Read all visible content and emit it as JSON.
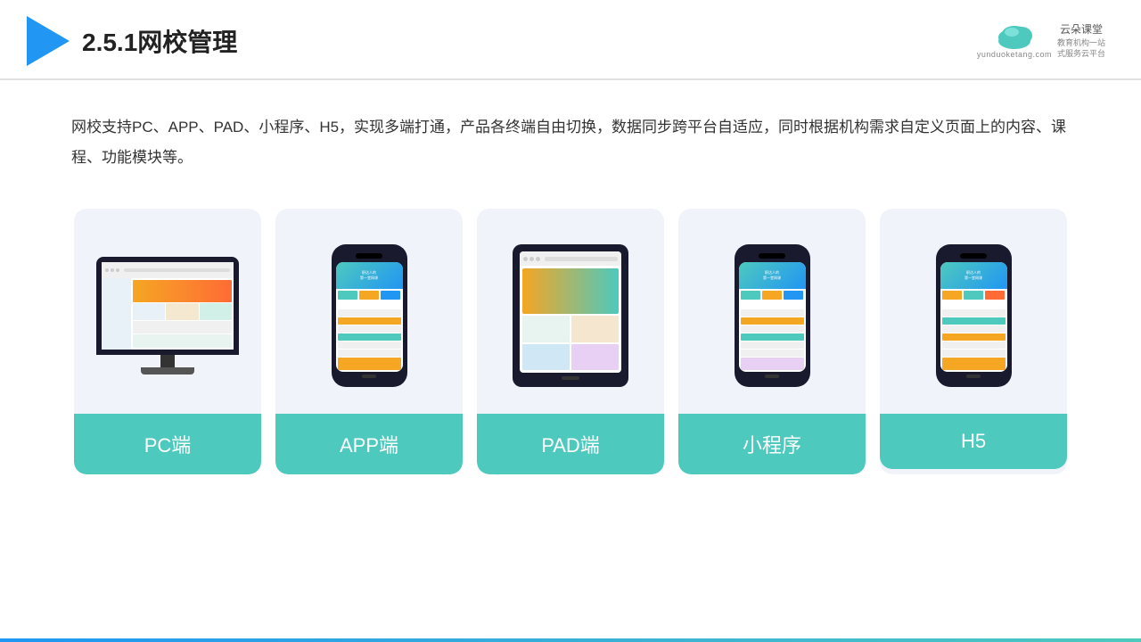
{
  "header": {
    "title": "2.5.1网校管理",
    "brand_name": "云朵课堂",
    "brand_url": "yunduoketang.com",
    "brand_slogan": "教育机构一站\n式服务云平台"
  },
  "description": {
    "text": "网校支持PC、APP、PAD、小程序、H5，实现多端打通，产品各终端自由切换，数据同步跨平台自适应，同时根据机构需求自定义页面上的内容、课程、功能模块等。"
  },
  "cards": [
    {
      "id": "pc",
      "label": "PC端"
    },
    {
      "id": "app",
      "label": "APP端"
    },
    {
      "id": "pad",
      "label": "PAD端"
    },
    {
      "id": "mini",
      "label": "小程序"
    },
    {
      "id": "h5",
      "label": "H5"
    }
  ],
  "accent_color": "#4dc9be"
}
